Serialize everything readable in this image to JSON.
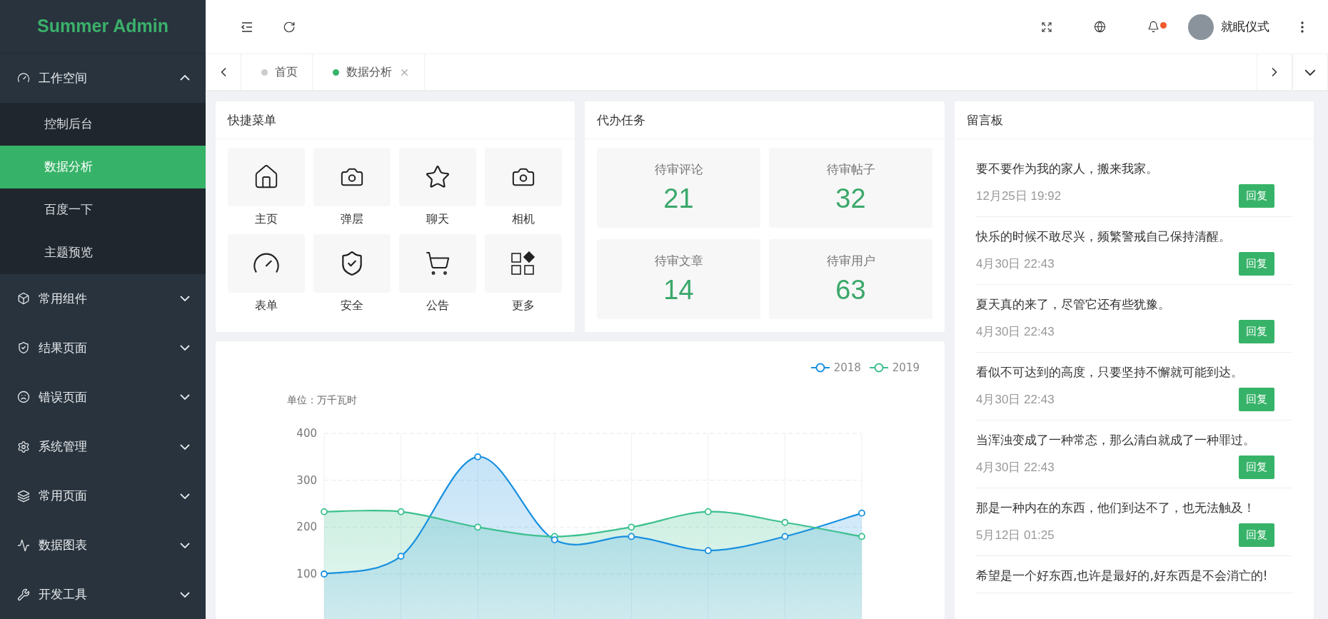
{
  "brand": "Summer Admin",
  "sidebar": {
    "items": [
      {
        "label": "工作空间",
        "expanded": true,
        "children": [
          {
            "label": "控制后台",
            "selected": false
          },
          {
            "label": "数据分析",
            "selected": true
          },
          {
            "label": "百度一下",
            "selected": false
          },
          {
            "label": "主题预览",
            "selected": false
          }
        ]
      },
      {
        "label": "常用组件",
        "expanded": false
      },
      {
        "label": "结果页面",
        "expanded": false
      },
      {
        "label": "错误页面",
        "expanded": false
      },
      {
        "label": "系统管理",
        "expanded": false
      },
      {
        "label": "常用页面",
        "expanded": false
      },
      {
        "label": "数据图表",
        "expanded": false
      },
      {
        "label": "开发工具",
        "expanded": false
      }
    ]
  },
  "header": {
    "user": "就眠仪式",
    "notification_dot": true
  },
  "tabs": [
    {
      "label": "首页",
      "selected": false
    },
    {
      "label": "数据分析",
      "selected": true
    }
  ],
  "quick_menu": {
    "title": "快捷菜单",
    "items": [
      {
        "label": "主页"
      },
      {
        "label": "弹层"
      },
      {
        "label": "聊天"
      },
      {
        "label": "相机"
      },
      {
        "label": "表单"
      },
      {
        "label": "安全"
      },
      {
        "label": "公告"
      },
      {
        "label": "更多"
      }
    ]
  },
  "tasks": {
    "title": "代办任务",
    "items": [
      {
        "label": "待审评论",
        "count": "21"
      },
      {
        "label": "待审帖子",
        "count": "32"
      },
      {
        "label": "待审文章",
        "count": "14"
      },
      {
        "label": "待审用户",
        "count": "63"
      }
    ]
  },
  "energy_chart": {
    "unit": "单位：万千瓦时",
    "chart_data": {
      "type": "area",
      "grid": true,
      "ylim": [
        0,
        400
      ],
      "yticks": [
        100,
        200,
        300,
        400
      ],
      "series": [
        {
          "name": "2018",
          "color": "#1890e0",
          "values": [
            100,
            138,
            350,
            173,
            180,
            150,
            180,
            230
          ]
        },
        {
          "name": "2019",
          "color": "#3cc08e",
          "values": [
            233,
            233,
            200,
            180,
            200,
            233,
            210,
            180
          ]
        }
      ]
    }
  },
  "message_board": {
    "title": "留言板",
    "messages": [
      {
        "text": "要不要作为我的家人，搬来我家。",
        "time": "12月25日 19:92",
        "reply": "回复"
      },
      {
        "text": "快乐的时候不敢尽兴，频繁警戒自己保持清醒。",
        "time": "4月30日 22:43",
        "reply": "回复"
      },
      {
        "text": "夏天真的来了，尽管它还有些犹豫。",
        "time": "4月30日 22:43",
        "reply": "回复"
      },
      {
        "text": "看似不可达到的高度，只要坚持不懈就可能到达。",
        "time": "4月30日 22:43",
        "reply": "回复"
      },
      {
        "text": "当浑浊变成了一种常态，那么清白就成了一种罪过。",
        "time": "4月30日 22:43",
        "reply": "回复"
      },
      {
        "text": "那是一种内在的东西，他们到达不了，也无法触及！",
        "time": "5月12日 01:25",
        "reply": "回复"
      },
      {
        "text": "希望是一个好东西,也许是最好的,好东西是不会消亡的!"
      }
    ]
  }
}
